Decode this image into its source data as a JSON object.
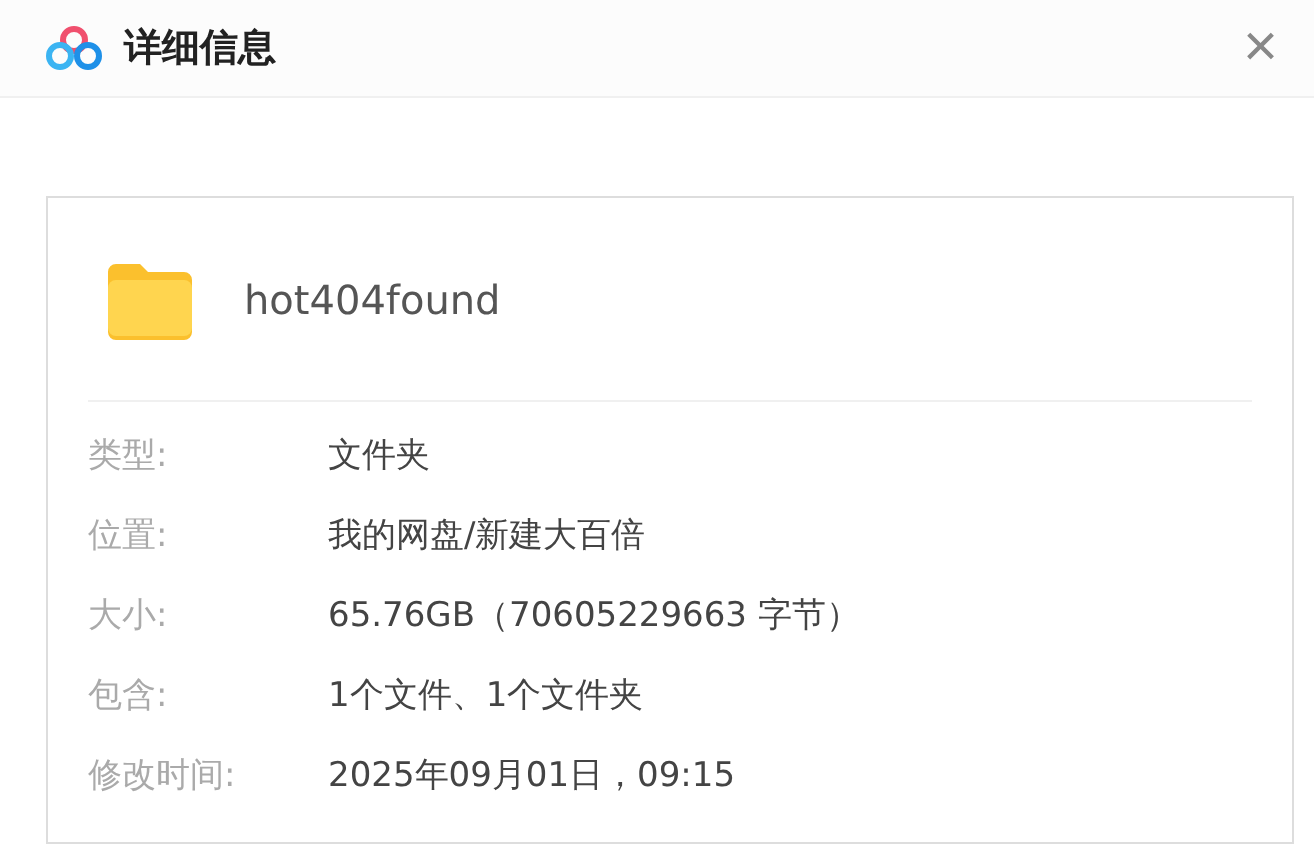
{
  "window": {
    "title": "详细信息",
    "close": "×"
  },
  "file": {
    "name": "hot404found"
  },
  "details": [
    {
      "label": "类型:",
      "value": "文件夹"
    },
    {
      "label": "位置:",
      "value": "我的网盘/新建大百倍"
    },
    {
      "label": "大小:",
      "value": "65.76GB（70605229663 字节）"
    },
    {
      "label": "包含:",
      "value": "1个文件、1个文件夹"
    },
    {
      "label": "修改时间:",
      "value": "2025年09月01日，09:15"
    }
  ]
}
